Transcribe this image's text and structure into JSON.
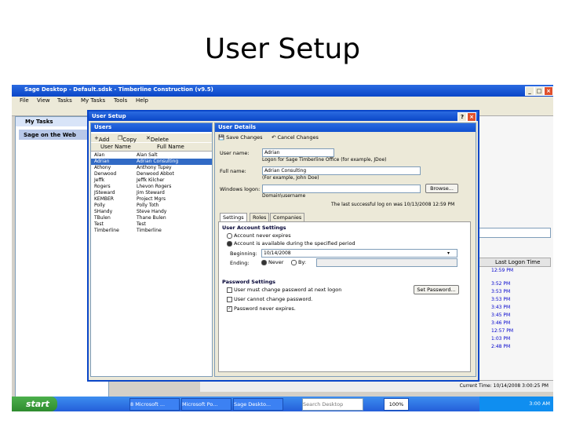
{
  "slide": {
    "title": "User Setup"
  },
  "app": {
    "title": "Sage Desktop - Default.sdsk - Timberline Construction (v9.5)",
    "menu": [
      "File",
      "View",
      "Tasks",
      "My Tasks",
      "Tools",
      "Help"
    ],
    "my_tasks_label": "My Tasks",
    "sage_web_label": "Sage on the Web"
  },
  "right_panel": {
    "last_logon_header": "Last Logon Time",
    "times": [
      "12:59 PM",
      "3:52 PM",
      "3:53 PM",
      "3:53 PM",
      "3:43 PM",
      "3:45 PM",
      "3:46 PM",
      "12:57 PM",
      "1:03 PM",
      "2:48 PM"
    ],
    "status": "Current Time: 10/14/2008 3:00:25 PM"
  },
  "dialog": {
    "title": "User Setup",
    "users_header": "Users",
    "add_label": "Add",
    "copy_label": "Copy",
    "delete_label": "Delete",
    "col_user": "User Name",
    "col_full": "Full Name",
    "users": [
      {
        "u": "Alan",
        "f": "Alan Salt"
      },
      {
        "u": "Adrian",
        "f": "Adrian Consulting"
      },
      {
        "u": "Athony",
        "f": "Anthony Tupey"
      },
      {
        "u": "Denwood",
        "f": "Denwood Abbot"
      },
      {
        "u": "Jeffk",
        "f": "Jeffk Kilcher"
      },
      {
        "u": "Rogers",
        "f": "Lhevon Rogers"
      },
      {
        "u": "JSteward",
        "f": "Jim Steward"
      },
      {
        "u": "KEMBER",
        "f": "Project Mgrs"
      },
      {
        "u": "Polly",
        "f": "Polly Toth"
      },
      {
        "u": "SHandy",
        "f": "Steve Handy"
      },
      {
        "u": "TBulen",
        "f": "Thane Bulen"
      },
      {
        "u": "Test",
        "f": "Test"
      },
      {
        "u": "Timberline",
        "f": "Timberline"
      }
    ],
    "details_header": "User Details",
    "save_changes": "Save Changes",
    "cancel_changes": "Cancel Changes",
    "user_name_label": "User name:",
    "user_name_value": "Adrian",
    "logon_hint": "Logon for Sage Timberline Office (for example, JDoe)",
    "full_name_label": "Full name:",
    "full_name_value": "Adrian Consulting",
    "full_name_hint": "(For example, John Doe)",
    "windows_logon_label": "Windows logon:",
    "windows_logon_hint": "Domain\\username",
    "browse": "Browse...",
    "last_logon": "The last successful log on was 10/13/2008 12:59 PM",
    "tabs": [
      "Settings",
      "Roles",
      "Companies"
    ],
    "account_settings": "User Account Settings",
    "account_never": "Account never expires",
    "account_expires": "Account is available during the specified period",
    "beginning_label": "Beginning:",
    "beginning_value": "10/14/2008",
    "ending_label": "Ending:",
    "ending_never": "Never",
    "ending_by": "By:",
    "password_settings": "Password Settings",
    "must_change": "User must change password at next logon",
    "cannot_change": "User cannot change password.",
    "never_expires": "Password never expires.",
    "set_password": "Set Password..."
  },
  "taskbar": {
    "start": "start",
    "items": [
      "8 Microsoft ...",
      "Microsoft Po...",
      "Sage Deskto..."
    ],
    "search_placeholder": "Search Desktop",
    "zoom": "100%",
    "clock": "3:00 AM"
  }
}
